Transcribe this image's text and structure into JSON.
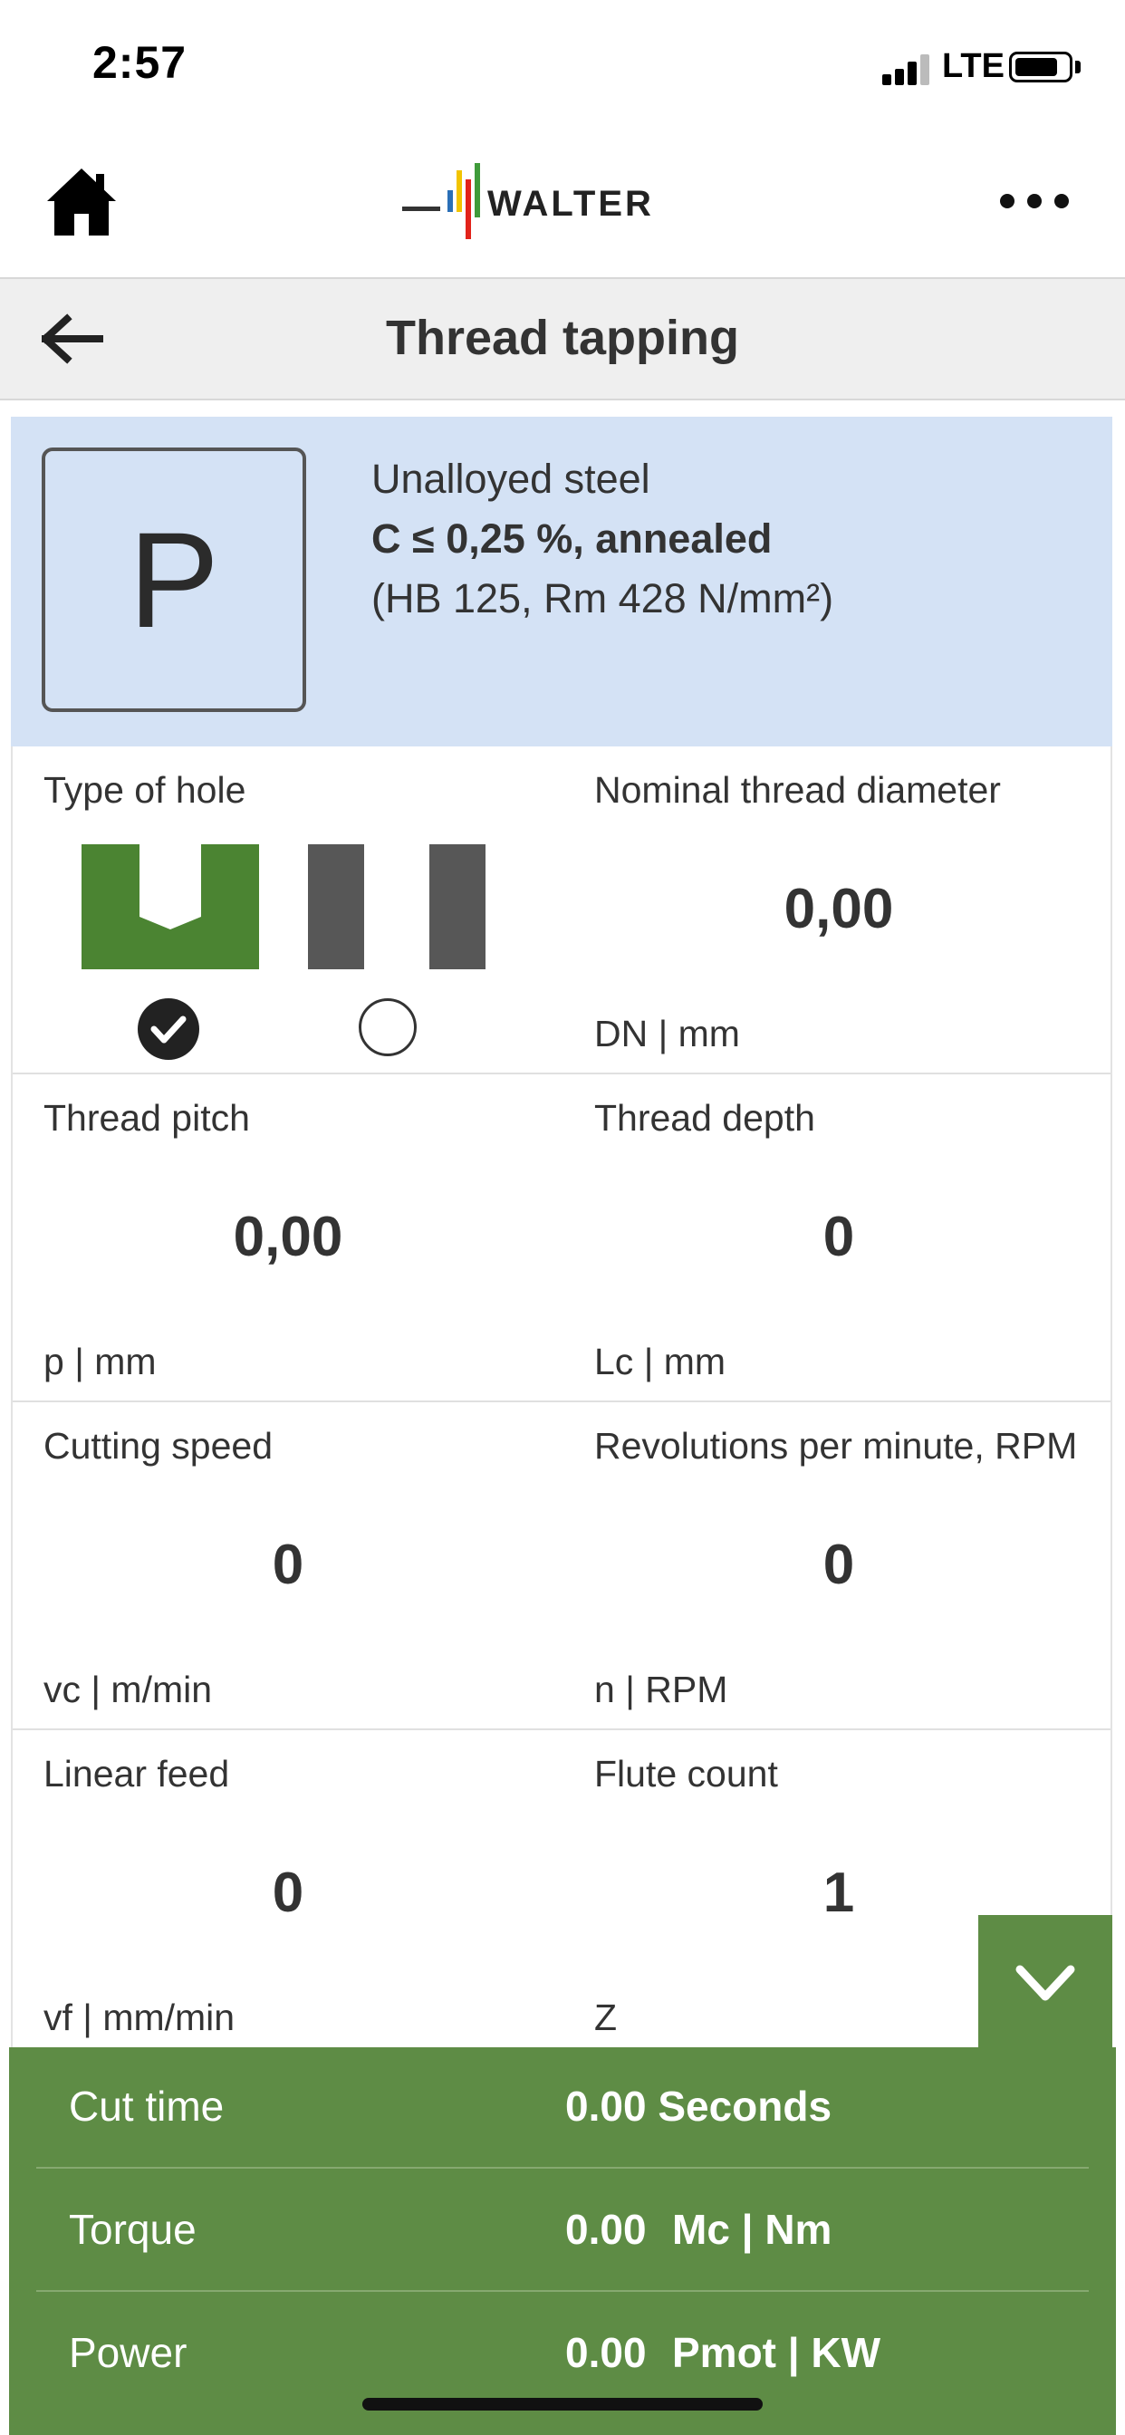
{
  "status": {
    "time": "2:57",
    "network": "LTE"
  },
  "header": {
    "brand": "WALTER"
  },
  "title_bar": {
    "title": "Thread tapping"
  },
  "material": {
    "group": "P",
    "name": "Unalloyed steel",
    "condition": "C ≤ 0,25 %, annealed",
    "hardness": "(HB 125, Rm 428 N/mm²)"
  },
  "fields": {
    "type_of_hole": {
      "label": "Type of hole",
      "selected": "blind"
    },
    "nominal_thread_diameter": {
      "label": "Nominal thread diameter",
      "value": "0,00",
      "unit": "DN | mm"
    },
    "thread_pitch": {
      "label": "Thread pitch",
      "value": "0,00",
      "unit": "p | mm"
    },
    "thread_depth": {
      "label": "Thread depth",
      "value": "0",
      "unit": "Lc | mm"
    },
    "cutting_speed": {
      "label": "Cutting speed",
      "value": "0",
      "unit": "vc | m/min"
    },
    "rpm": {
      "label": "Revolutions per minute, RPM",
      "value": "0",
      "unit": "n | RPM"
    },
    "linear_feed": {
      "label": "Linear feed",
      "value": "0",
      "unit": "vf | mm/min"
    },
    "flute_count": {
      "label": "Flute count",
      "value": "1",
      "unit": "Z"
    }
  },
  "results": {
    "cut_time": {
      "label": "Cut time",
      "value": "0.00",
      "unit": "Seconds"
    },
    "torque": {
      "label": "Torque",
      "value": "0.00",
      "unit": "Mc | Nm"
    },
    "power": {
      "label": "Power",
      "value": "0.00",
      "unit": "Pmot | KW"
    }
  },
  "colors": {
    "accent_green": "#5e8c45",
    "material_bg": "#d4e2f5",
    "hole_active": "#4b8432",
    "hole_inactive": "#575757"
  },
  "icons": {
    "home": "home-icon",
    "more": "more-icon",
    "back": "back-arrow-icon",
    "collapse": "chevron-down-icon",
    "check": "check-icon"
  }
}
